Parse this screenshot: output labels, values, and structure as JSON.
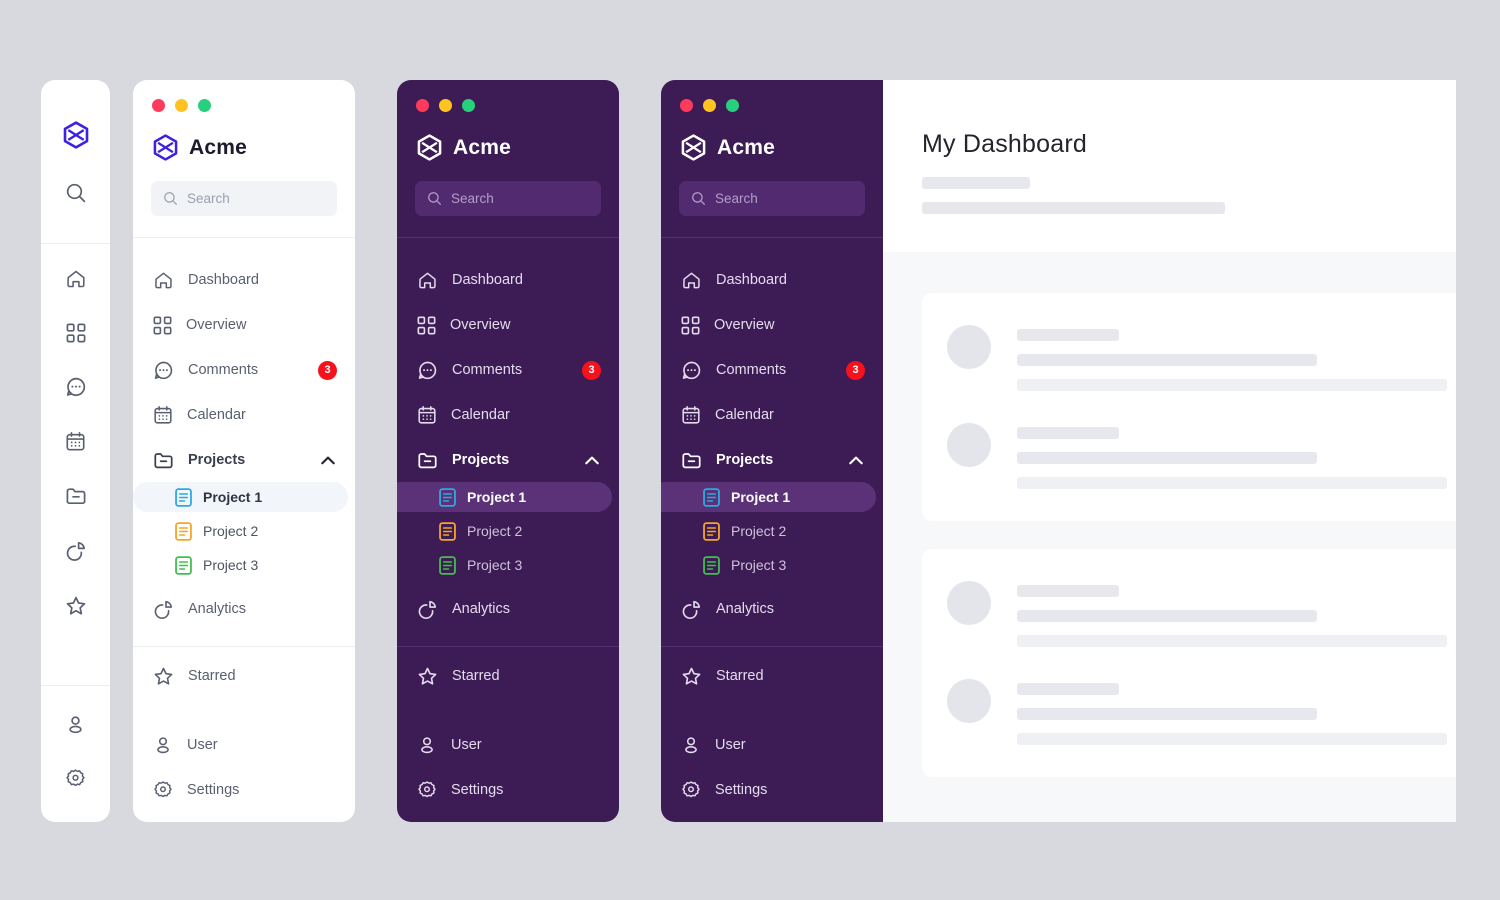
{
  "brand": {
    "name": "Acme",
    "logo_icon": "hexagon-x-logo",
    "accent_color": "#3d21e0"
  },
  "traffic_lights": [
    "#ff3b5c",
    "#ffc421",
    "#26d07c"
  ],
  "search": {
    "placeholder": "Search",
    "icon": "search-icon"
  },
  "rail": {
    "icons_top": [
      "home-icon",
      "grid-icon",
      "chat-icon",
      "calendar-icon",
      "folder-minus-icon",
      "pie-chart-icon",
      "star-icon"
    ],
    "icons_bottom": [
      "user-icon",
      "gear-icon"
    ],
    "logo_icon": "hexagon-x-logo",
    "search_icon": "search-icon"
  },
  "nav": {
    "items": [
      {
        "label": "Dashboard",
        "icon": "home-icon"
      },
      {
        "label": "Overview",
        "icon": "grid-icon"
      },
      {
        "label": "Comments",
        "icon": "chat-icon",
        "badge": "3"
      },
      {
        "label": "Calendar",
        "icon": "calendar-icon"
      }
    ],
    "group": {
      "label": "Projects",
      "icon": "folder-minus-icon",
      "chevron": "chevron-up-icon",
      "expanded": true,
      "children": [
        {
          "label": "Project 1",
          "icon": "document-icon",
          "color": "#29abe2",
          "active": true
        },
        {
          "label": "Project 2",
          "icon": "document-icon",
          "color": "#f5a623",
          "active": false
        },
        {
          "label": "Project 3",
          "icon": "document-icon",
          "color": "#3ec14b",
          "active": false
        }
      ]
    },
    "analytics": {
      "label": "Analytics",
      "icon": "pie-chart-icon"
    },
    "starred": {
      "label": "Starred",
      "icon": "star-icon"
    },
    "bottom": [
      {
        "label": "User",
        "icon": "user-icon"
      },
      {
        "label": "Settings",
        "icon": "gear-icon"
      }
    ]
  },
  "dashboard": {
    "title": "My Dashboard",
    "cards": [
      {
        "rows": 2
      },
      {
        "rows": 2
      }
    ]
  },
  "theme": {
    "canvas_bg": "#d7d9de",
    "light_panel_bg": "#ffffff",
    "dark_panel_bg": "#3d1c56",
    "dark_search_bg": "#522a70",
    "dark_active_bg": "#5b3277",
    "light_search_bg": "#f1f3f7",
    "light_active_bg": "#f2f5f9",
    "badge_bg": "#f5121d",
    "dashboard_bg": "#f7f8fa",
    "skeleton": "#e6e8ed"
  }
}
